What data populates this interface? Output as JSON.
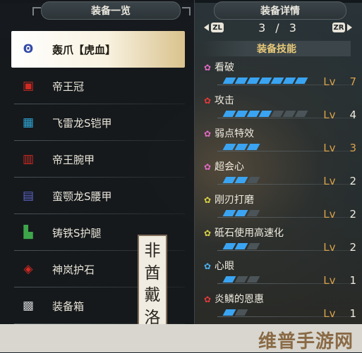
{
  "left_panel": {
    "title": "装备一览",
    "items": [
      {
        "label": "轰爪【虎血】",
        "icon": "claw-icon",
        "glyph": "Ꙩ",
        "selected": true
      },
      {
        "label": "帝王冠",
        "icon": "helmet-icon",
        "glyph": "▣"
      },
      {
        "label": "飞雷龙S铠甲",
        "icon": "chest-armor-icon",
        "glyph": "▦"
      },
      {
        "label": "帝王腕甲",
        "icon": "arm-armor-icon",
        "glyph": "▥"
      },
      {
        "label": "蛮颚龙S腰甲",
        "icon": "waist-armor-icon",
        "glyph": "▤"
      },
      {
        "label": "铸铁S护腿",
        "icon": "leg-armor-icon",
        "glyph": "▙"
      },
      {
        "label": "神岚护石",
        "icon": "charm-icon",
        "glyph": "◈"
      },
      {
        "label": "装备箱",
        "icon": "equipment-box-icon",
        "glyph": "▩"
      }
    ]
  },
  "seal": [
    "非",
    "酋",
    "戴",
    "洛"
  ],
  "right_panel": {
    "title": "装备详情",
    "pager": {
      "left_button": "ZL",
      "right_button": "ZR",
      "current": "3",
      "separator": "/",
      "total": "3"
    },
    "skills_header": "装备技能",
    "skills": [
      {
        "name": "看破",
        "gem": "pink",
        "level": 7,
        "max": 7,
        "lv_label": "Lv",
        "value": "7"
      },
      {
        "name": "攻击",
        "gem": "red",
        "level": 4,
        "max": 7,
        "lv_label": "Lv",
        "value": "4"
      },
      {
        "name": "弱点特效",
        "gem": "pink",
        "level": 3,
        "max": 3,
        "lv_label": "Lv",
        "value": "3"
      },
      {
        "name": "超会心",
        "gem": "pink",
        "level": 2,
        "max": 3,
        "lv_label": "Lv",
        "value": "2"
      },
      {
        "name": "刚刃打磨",
        "gem": "yellow",
        "level": 2,
        "max": 3,
        "lv_label": "Lv",
        "value": "2"
      },
      {
        "name": "砥石使用高速化",
        "gem": "yellow",
        "level": 2,
        "max": 3,
        "lv_label": "Lv",
        "value": "2"
      },
      {
        "name": "心眼",
        "gem": "blue",
        "level": 1,
        "max": 3,
        "lv_label": "Lv",
        "value": "1"
      },
      {
        "name": "炎鳞的恩惠",
        "gem": "red",
        "level": 1,
        "max": 2,
        "lv_label": "Lv",
        "value": "1"
      }
    ]
  },
  "watermark": "维普手游网",
  "colors": {
    "accent_blue": "#3aa4f2",
    "level_orange": "#d8a24a",
    "skill_header": "#e8c879"
  }
}
